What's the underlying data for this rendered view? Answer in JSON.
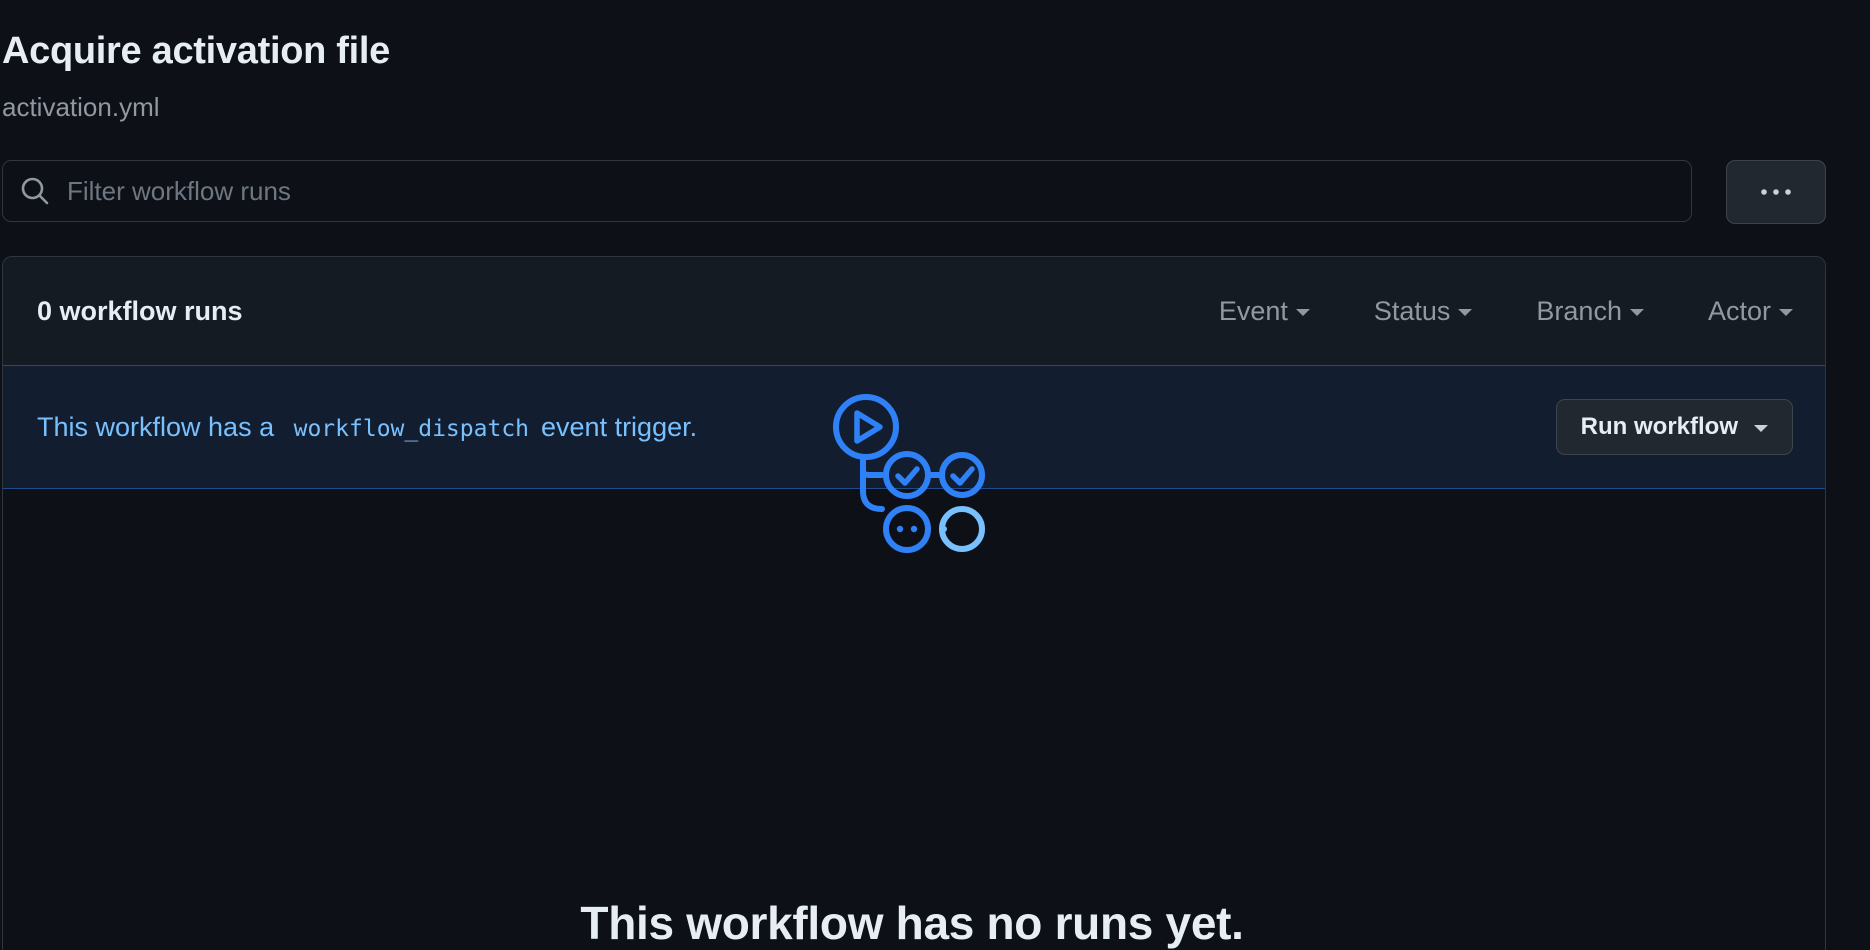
{
  "workflow": {
    "title": "Acquire activation file",
    "file": "activation.yml"
  },
  "search": {
    "placeholder": "Filter workflow runs"
  },
  "more_button": {
    "label": "···"
  },
  "runs": {
    "count_label": "0 workflow runs",
    "filters": [
      {
        "label": "Event"
      },
      {
        "label": "Status"
      },
      {
        "label": "Branch"
      },
      {
        "label": "Actor"
      }
    ]
  },
  "dispatch": {
    "text_before": "This workflow has a",
    "code": "workflow_dispatch",
    "text_after": "event trigger.",
    "button_label": "Run workflow"
  },
  "blankslate": {
    "title": "This workflow has no runs yet."
  },
  "colors": {
    "background": "#0d1117",
    "accent_blue": "#2f81f7",
    "link_blue": "#79c0ff"
  },
  "icons": {
    "search": "search-icon",
    "more": "kebab-horizontal-icon",
    "empty_state": "workflow-graph-icon"
  }
}
